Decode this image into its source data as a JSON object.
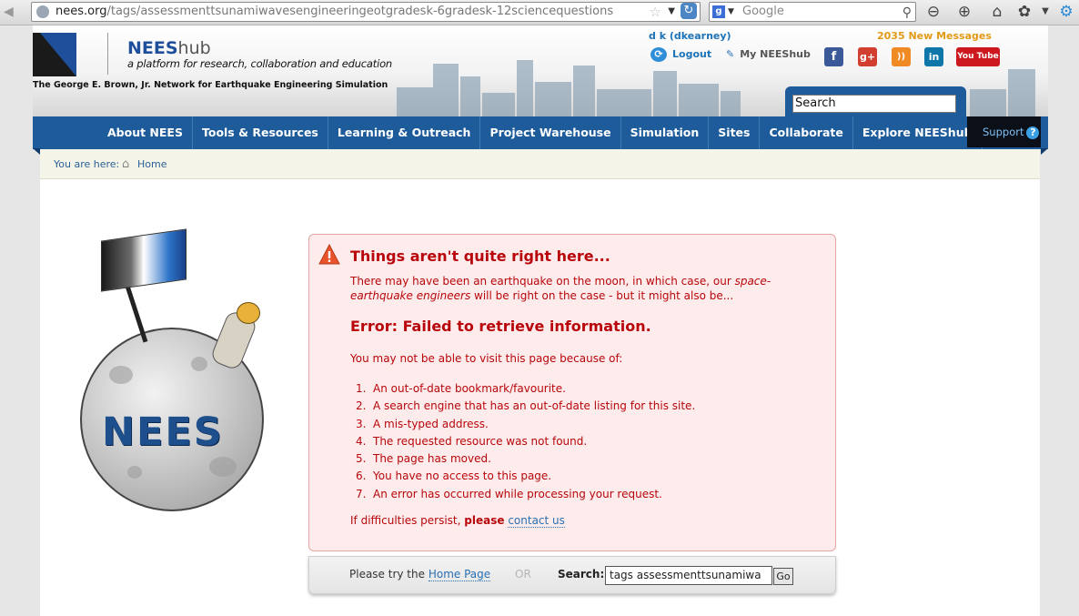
{
  "browser": {
    "url_host": "nees.org",
    "url_path": "/tags/assessmenttsunamiwavesengineeringeotgradesk-6gradesk-12sciencequestions",
    "search_placeholder": "Google"
  },
  "header": {
    "logo_title": "NEES",
    "logo_title_suffix": "hub",
    "tagline": "a platform for research, collaboration and education",
    "caption": "The George E. Brown, Jr. Network for Earthquake Engineering Simulation",
    "user": "d k (dkearney)",
    "messages": "2035 New Messages",
    "logout": "Logout",
    "my_account": "My NEEShub",
    "search_value": "Search",
    "social": [
      {
        "name": "facebook-icon",
        "glyph": "f",
        "color": "#3b5998"
      },
      {
        "name": "google-plus-icon",
        "glyph": "g+",
        "color": "#d23f31"
      },
      {
        "name": "rss-icon",
        "glyph": "))",
        "color": "#f08a24"
      },
      {
        "name": "linkedin-icon",
        "glyph": "in",
        "color": "#0e76a8"
      },
      {
        "name": "youtube-icon",
        "glyph": "You Tube",
        "color": "#cc181e"
      }
    ]
  },
  "nav": {
    "items": [
      "About NEES",
      "Tools & Resources",
      "Learning & Outreach",
      "Project Warehouse",
      "Simulation",
      "Sites",
      "Collaborate",
      "Explore NEEShub"
    ],
    "support": "Support"
  },
  "breadcrumb": {
    "label": "You are here:",
    "home": "Home"
  },
  "illustration": {
    "word": "NEES"
  },
  "error": {
    "title": "Things aren't quite right here...",
    "intro_plain": "There may have been an earthquake on the moon, in which case, our ",
    "intro_em": "space-earthquake engineers",
    "intro_tail": " will be right on the case - but it might also be...",
    "heading": "Error: Failed to retrieve information.",
    "lead": "You may not be able to visit this page because of:",
    "reasons": [
      "An out-of-date bookmark/favourite.",
      "A search engine that has an out-of-date listing for this site.",
      "A mis-typed address.",
      "The requested resource was not found.",
      "The page has moved.",
      "You have no access to this page.",
      "An error has occurred while processing your request."
    ],
    "footer_plain": "If difficulties persist, ",
    "footer_bold": "please",
    "footer_link": "contact us"
  },
  "try_bar": {
    "text": "Please try the ",
    "home_link": "Home Page",
    "or": "OR",
    "search_label": "Search:",
    "search_value": "tags assessmenttsunamiwa",
    "go": "Go"
  },
  "colors": {
    "nav_blue": "#1d5b9a",
    "error_red": "#b8060c",
    "error_bg": "#fdeceb",
    "link_blue": "#2a6fb2",
    "message_orange": "#e29a16"
  }
}
